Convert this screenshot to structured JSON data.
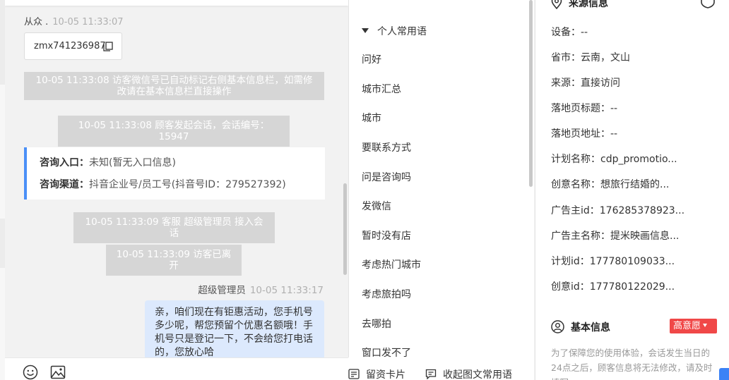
{
  "chat": {
    "sender_name": "从众 .",
    "sender_time": "10-05 11:33:07",
    "wechat_id": "zmx741236987",
    "system_messages": [
      "10-05 11:33:08 访客微信号已自动标记右侧基本信息栏，如需修改请在基本信息栏直接操作",
      "10-05 11:33:08 顾客发起会话，会话编号：15947",
      "10-05 11:33:09 客服 超级管理员 接入会话",
      "10-05 11:33:09 访客已离开"
    ],
    "info_card": {
      "entry_label": "咨询入口：",
      "entry_value": "未知(暂无入口信息)",
      "channel_label": "咨询渠道：",
      "channel_value": "抖音企业号/员工号(抖音号ID：279527392)"
    },
    "agent_name": "超级管理员",
    "agent_time": "10-05 11:33:17",
    "agent_message": "亲，咱们现在有钜惠活动，您手机号多少呢，帮您预留个优惠名额哦！手机号只是登记一下，不会给您打电话的，您放心哈"
  },
  "toolbar": {
    "emoji_icon": "emoji-icon",
    "image_icon": "image-icon",
    "card_label": "留资卡片",
    "collapse_label": "收起图文常用语"
  },
  "phrases": {
    "group_title": "个人常用语",
    "items": [
      "问好",
      "城市汇总",
      "城市",
      "要联系方式",
      "问是咨询吗",
      "发微信",
      "暂时没有店",
      "考虑热门城市",
      "考虑旅拍吗",
      "去哪拍",
      "窗口发不了"
    ]
  },
  "source_info": {
    "title": "来源信息",
    "fields": [
      "设备：--",
      "省市：云南，文山",
      "来源：直接访问",
      "落地页标题：--",
      "落地页地址：--",
      "计划名称：cdp_promotio...",
      "创意名称：想旅行结婚的...",
      "广告主id：176285378923...",
      "广告主名称：提米映画信息...",
      "计划id：177780109033...",
      "创意id：177780122029..."
    ]
  },
  "basic_info": {
    "title": "基本信息",
    "intent_badge": "高意愿",
    "notice": "为了保障您的使用体验，会话发生当日的24点之后，顾客信息将无法修改，请及时填写"
  },
  "colors": {
    "accent_blue": "#4a8ff7",
    "bubble_blue": "#dce9fd",
    "badge_red": "#f04848",
    "system_gray": "#d6d6d6"
  }
}
